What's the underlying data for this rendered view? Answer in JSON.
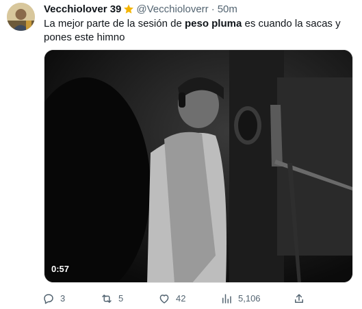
{
  "tweet": {
    "author_name": "Vecchiolover 39",
    "handle": "@Vecchioloverr",
    "separator": "·",
    "time": "50m",
    "text_part1": "La mejor parte de la sesión de ",
    "text_bold": "peso pluma",
    "text_part2": " es cuando la sacas y pones este himno"
  },
  "media": {
    "type": "video",
    "duration": "0:57"
  },
  "actions": {
    "replies": "3",
    "retweets": "5",
    "likes": "42",
    "views": "5,106"
  },
  "icons": {
    "verified": "star-icon",
    "reply": "reply-icon",
    "retweet": "retweet-icon",
    "like": "heart-icon",
    "views": "views-icon",
    "share": "share-icon"
  },
  "colors": {
    "text": "#0f1419",
    "secondary": "#536471",
    "star": "#f4b400"
  }
}
